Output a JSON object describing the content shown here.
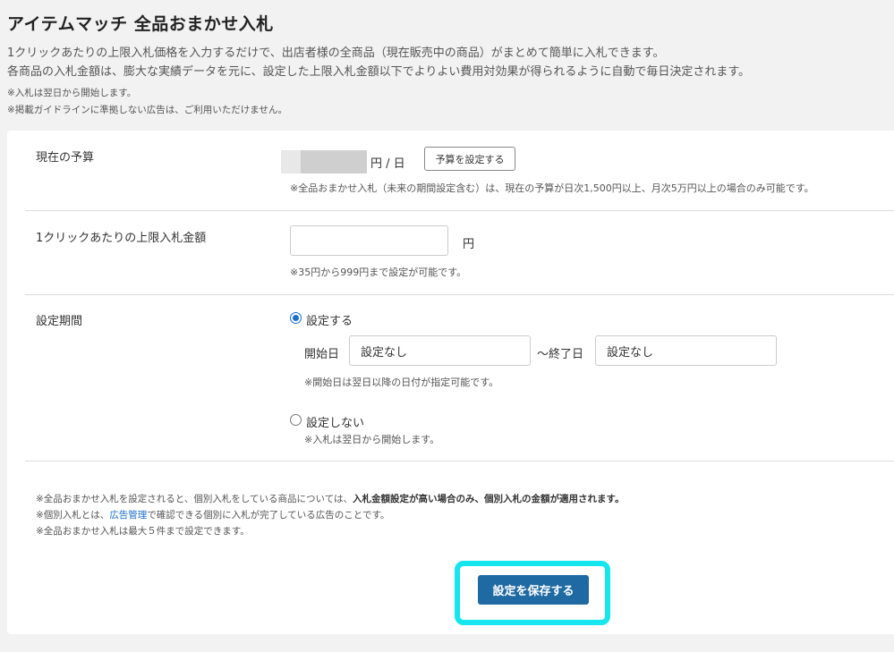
{
  "header": {
    "title": "アイテムマッチ 全品おまかせ入札",
    "desc1": "1クリックあたりの上限入札価格を入力するだけで、出店者様の全商品（現在販売中の商品）がまとめて簡単に入札できます。",
    "desc2": "各商品の入札金額は、膨大な実績データを元に、設定した上限入札金額以下でよりよい費用対効果が得られるように自動で毎日決定されます。",
    "note1": "※入札は翌日から開始します。",
    "note2": "※掲載ガイドラインに準拠しない広告は、ご利用いただけません。"
  },
  "budget": {
    "label": "現在の予算",
    "unit": "円 / 日",
    "set_button": "予算を設定する",
    "hint": "※全品おまかせ入札（未来の期間設定含む）は、現在の予算が日次1,500円以上、月次5万円以上の場合のみ可能です。"
  },
  "max_bid": {
    "label": "1クリックあたりの上限入札金額",
    "value": "",
    "unit": "円",
    "hint": "※35円から999円まで設定が可能です。"
  },
  "period": {
    "label": "設定期間",
    "option_set": "設定する",
    "start_label": "開始日",
    "start_value": "設定なし",
    "end_label": "～終了日",
    "end_value": "設定なし",
    "date_hint": "※開始日は翌日以降の日付が指定可能です。",
    "option_unset": "設定しない",
    "unset_hint": "※入札は翌日から開始します。"
  },
  "notes": {
    "n1_a": "※全品おまかせ入札を設定されると、個別入札をしている商品については、",
    "n1_b": "入札金額設定が高い場合のみ、個別入札の金額が適用されます。",
    "n2_a": "※個別入札とは、",
    "n2_link": "広告管理",
    "n2_b": "で確認できる個別に入札が完了している広告のことです。",
    "n3": "※全品おまかせ入札は最大５件まで設定できます。"
  },
  "save_button": "設定を保存する",
  "colors": {
    "accent": "#1f6aa3",
    "highlight": "#15e6ee",
    "link": "#1a6fd0"
  }
}
